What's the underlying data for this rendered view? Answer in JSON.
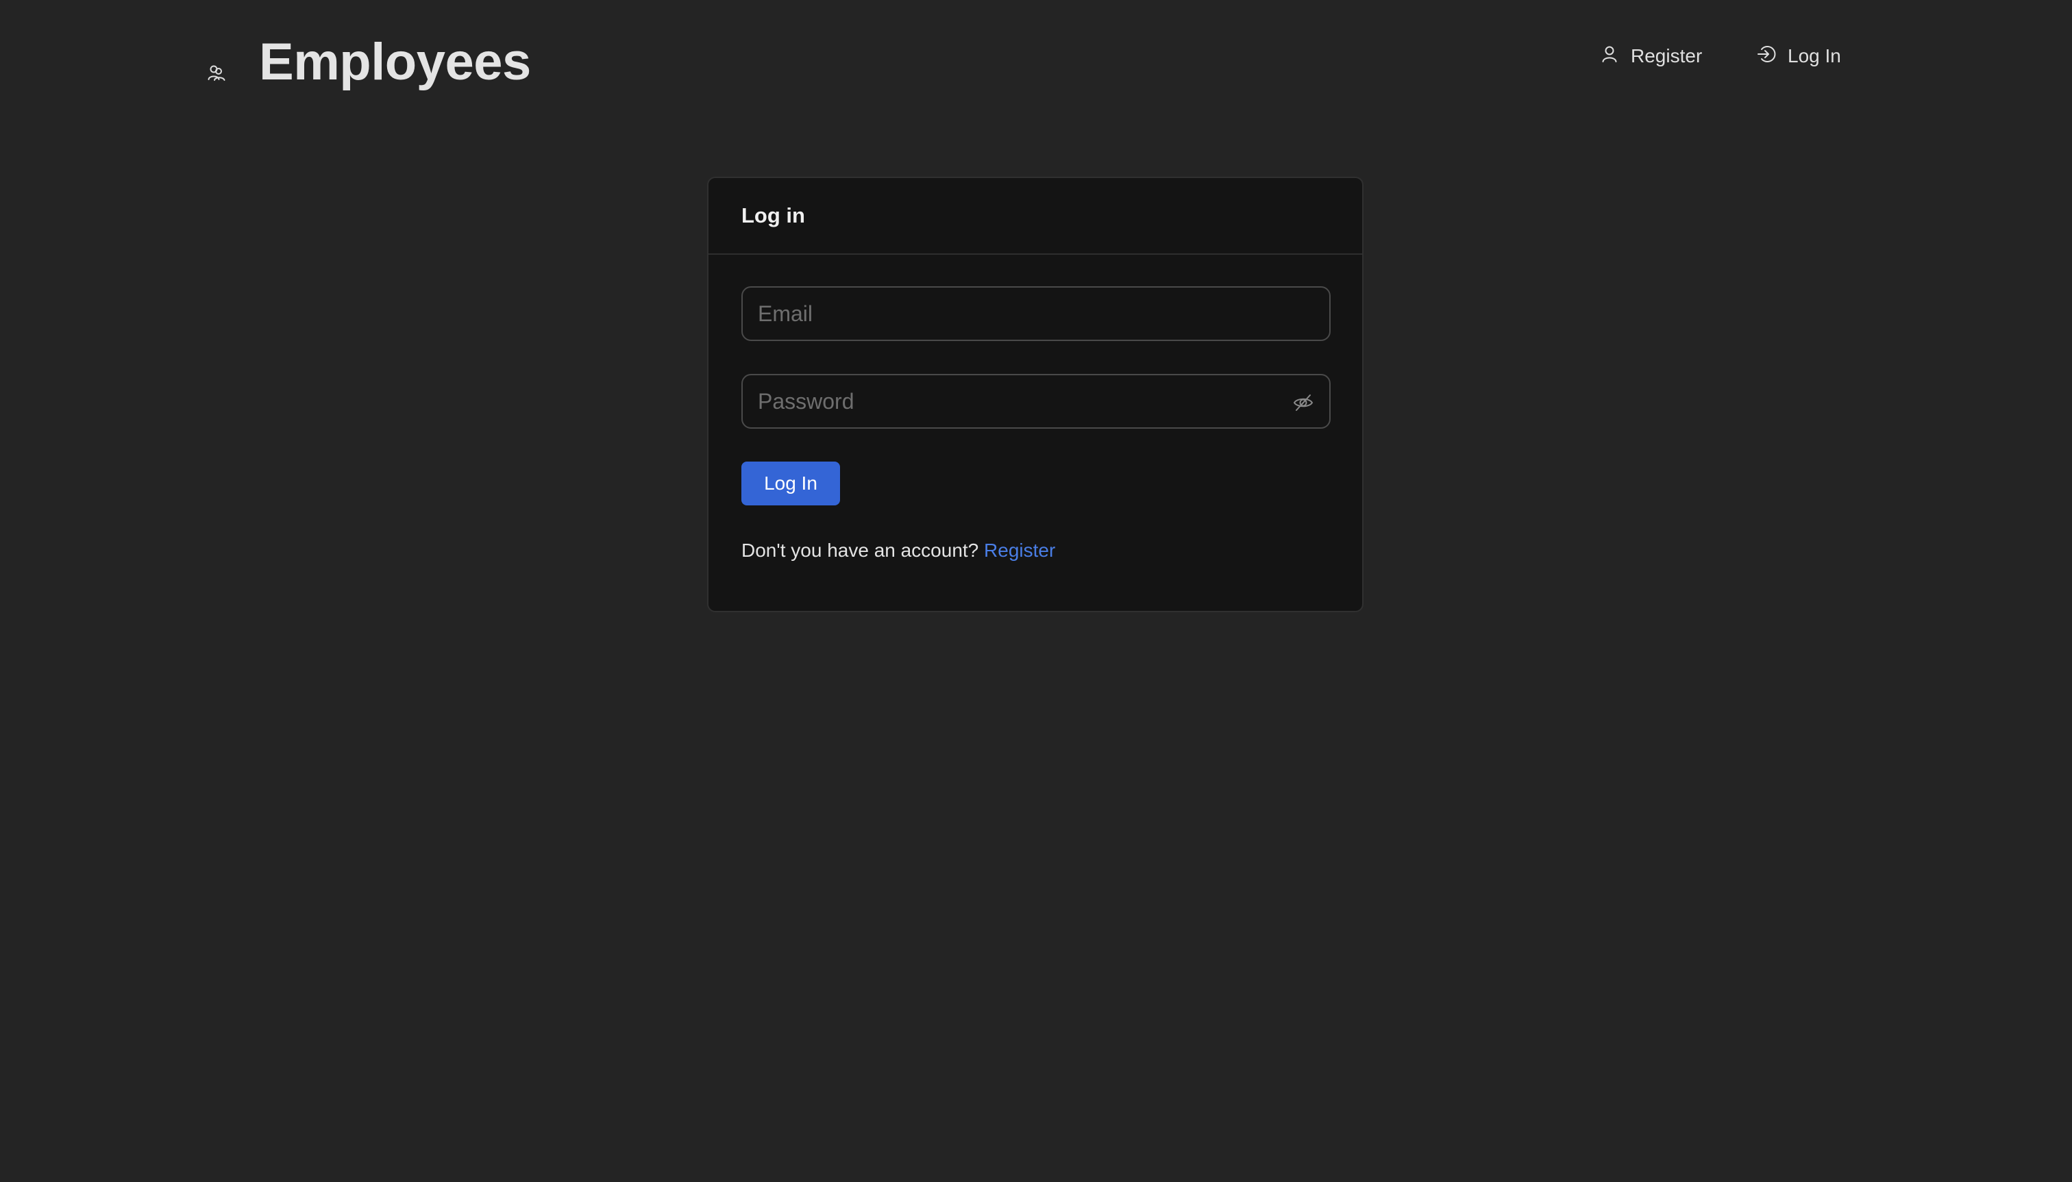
{
  "header": {
    "brand_icon": "users-icon",
    "title": "Employees",
    "nav": {
      "register": {
        "label": "Register",
        "icon": "user-icon"
      },
      "login": {
        "label": "Log In",
        "icon": "login-icon"
      }
    }
  },
  "login_card": {
    "title": "Log in",
    "email": {
      "placeholder": "Email",
      "value": ""
    },
    "password": {
      "placeholder": "Password",
      "value": "",
      "toggle_icon": "eye-slash-icon"
    },
    "submit_label": "Log In",
    "register_prompt": "Don't you have an account?",
    "register_link": "Register"
  },
  "colors": {
    "background": "#242424",
    "card": "#141414",
    "accent": "#3465d6",
    "link": "#4a7ee6"
  }
}
